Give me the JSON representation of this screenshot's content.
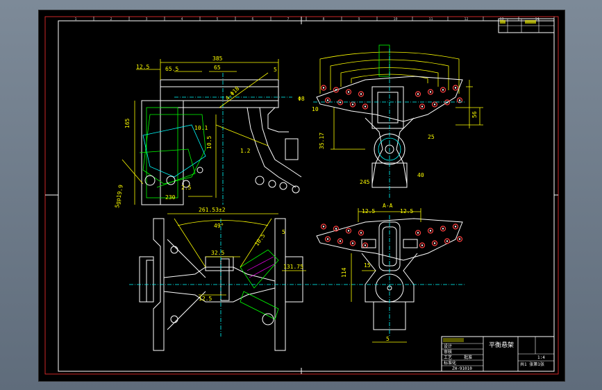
{
  "drawing": {
    "border_color": "#ff0000",
    "line_colors": {
      "outline": "#ffffff",
      "dimension": "#ffff00",
      "hatch": "#00ff00",
      "center": "#00ffff",
      "hole": "#ff4040"
    }
  },
  "top_left_view": {
    "dims": [
      "385",
      "12.5",
      "65.5",
      "65",
      "165",
      "10.1",
      "5gp19.9",
      "230",
      "2.5",
      "10.5",
      "4-Φ18",
      "1.2",
      "5"
    ]
  },
  "top_right_view": {
    "dims": [
      "35.17",
      "56",
      "Φ8",
      "10",
      "25",
      "40",
      "245"
    ]
  },
  "bottom_left_view": {
    "dims": [
      "261.53±2",
      "49°",
      "32.5",
      "12.5",
      "10.5",
      "131.75",
      "5"
    ]
  },
  "bottom_right_view": {
    "dims": [
      "A-A",
      "12.5",
      "12.5",
      "114",
      "15",
      "5"
    ]
  },
  "title_block": {
    "part_name": "平衡悬架",
    "scale": "1:4",
    "sheet": "共1 张第1张",
    "drawing_no": "ZH-91010",
    "labels": [
      "设计",
      "审核",
      "工艺",
      "标准化",
      "批准"
    ]
  },
  "top_right_table": {
    "cells": [
      "",
      "",
      "",
      "",
      "",
      ""
    ]
  },
  "zone_numbers": [
    "1",
    "2",
    "3",
    "4",
    "5",
    "6",
    "7",
    "8",
    "9",
    "10",
    "11",
    "12",
    "13",
    "14"
  ]
}
